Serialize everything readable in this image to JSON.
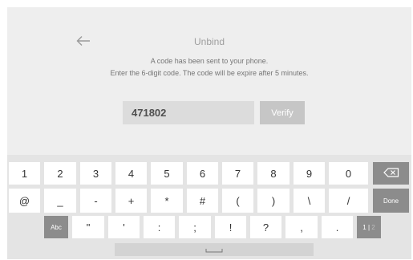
{
  "header": {
    "title": "Unbind",
    "back_icon": "arrow-left-icon"
  },
  "message": {
    "line1": "A code has been sent to your phone.",
    "line2": "Enter the 6-digit code. The code will be expire after 5 minutes."
  },
  "code_input": {
    "value": "471802"
  },
  "verify_button": {
    "label": "Verify"
  },
  "keyboard": {
    "row1": [
      "1",
      "2",
      "3",
      "4",
      "5",
      "6",
      "7",
      "8",
      "9",
      "0"
    ],
    "backspace_icon": "backspace-icon",
    "row2": [
      "@",
      "_",
      "-",
      "+",
      "*",
      "#",
      "(",
      ")",
      "\\",
      "/"
    ],
    "done_label": "Done",
    "abc_label": "Abc",
    "row3": [
      "\"",
      "'",
      ":",
      ";",
      "!",
      "?",
      ",",
      "."
    ],
    "page_current": "1",
    "page_separator": "|",
    "page_other": "2",
    "space_icon": "space-icon"
  },
  "colors": {
    "screen_bg": "#eeeeee",
    "keyboard_bg": "#e4e4e4",
    "key_bg": "#ffffff",
    "dark_key_bg": "#8c8c8c",
    "verify_bg": "#c6c6c6",
    "input_bg": "#dcdcdc"
  }
}
